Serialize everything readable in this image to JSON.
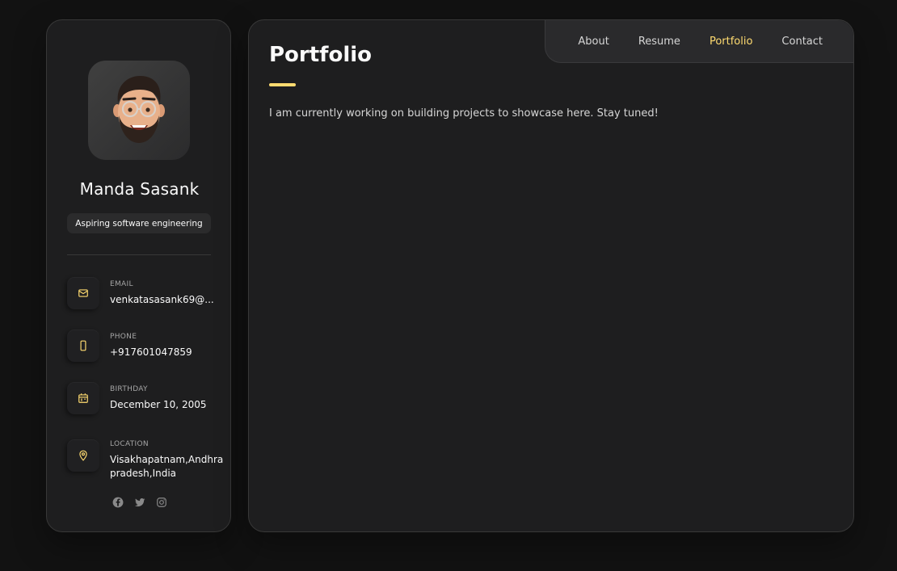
{
  "sidebar": {
    "name": "Manda Sasank",
    "title": "Aspiring software engineering",
    "contacts": [
      {
        "label": "EMAIL",
        "value": "venkatasasank69@...",
        "icon": "mail-icon"
      },
      {
        "label": "PHONE",
        "value": "+917601047859",
        "icon": "phone-icon"
      },
      {
        "label": "BIRTHDAY",
        "value": "December 10, 2005",
        "icon": "calendar-icon"
      },
      {
        "label": "LOCATION",
        "value": "Visakhapatnam,Andhra pradesh,India",
        "icon": "location-pin-icon"
      }
    ],
    "social": [
      "facebook-icon",
      "twitter-icon",
      "instagram-icon"
    ]
  },
  "nav": {
    "links": [
      "About",
      "Resume",
      "Portfolio",
      "Contact"
    ],
    "active": "Portfolio"
  },
  "main": {
    "title": "Portfolio",
    "text": "I am currently working on building projects to showcase here. Stay tuned!"
  },
  "colors": {
    "accent": "#ffdb70",
    "background": "#121212",
    "panel": "#1e1e1f"
  }
}
